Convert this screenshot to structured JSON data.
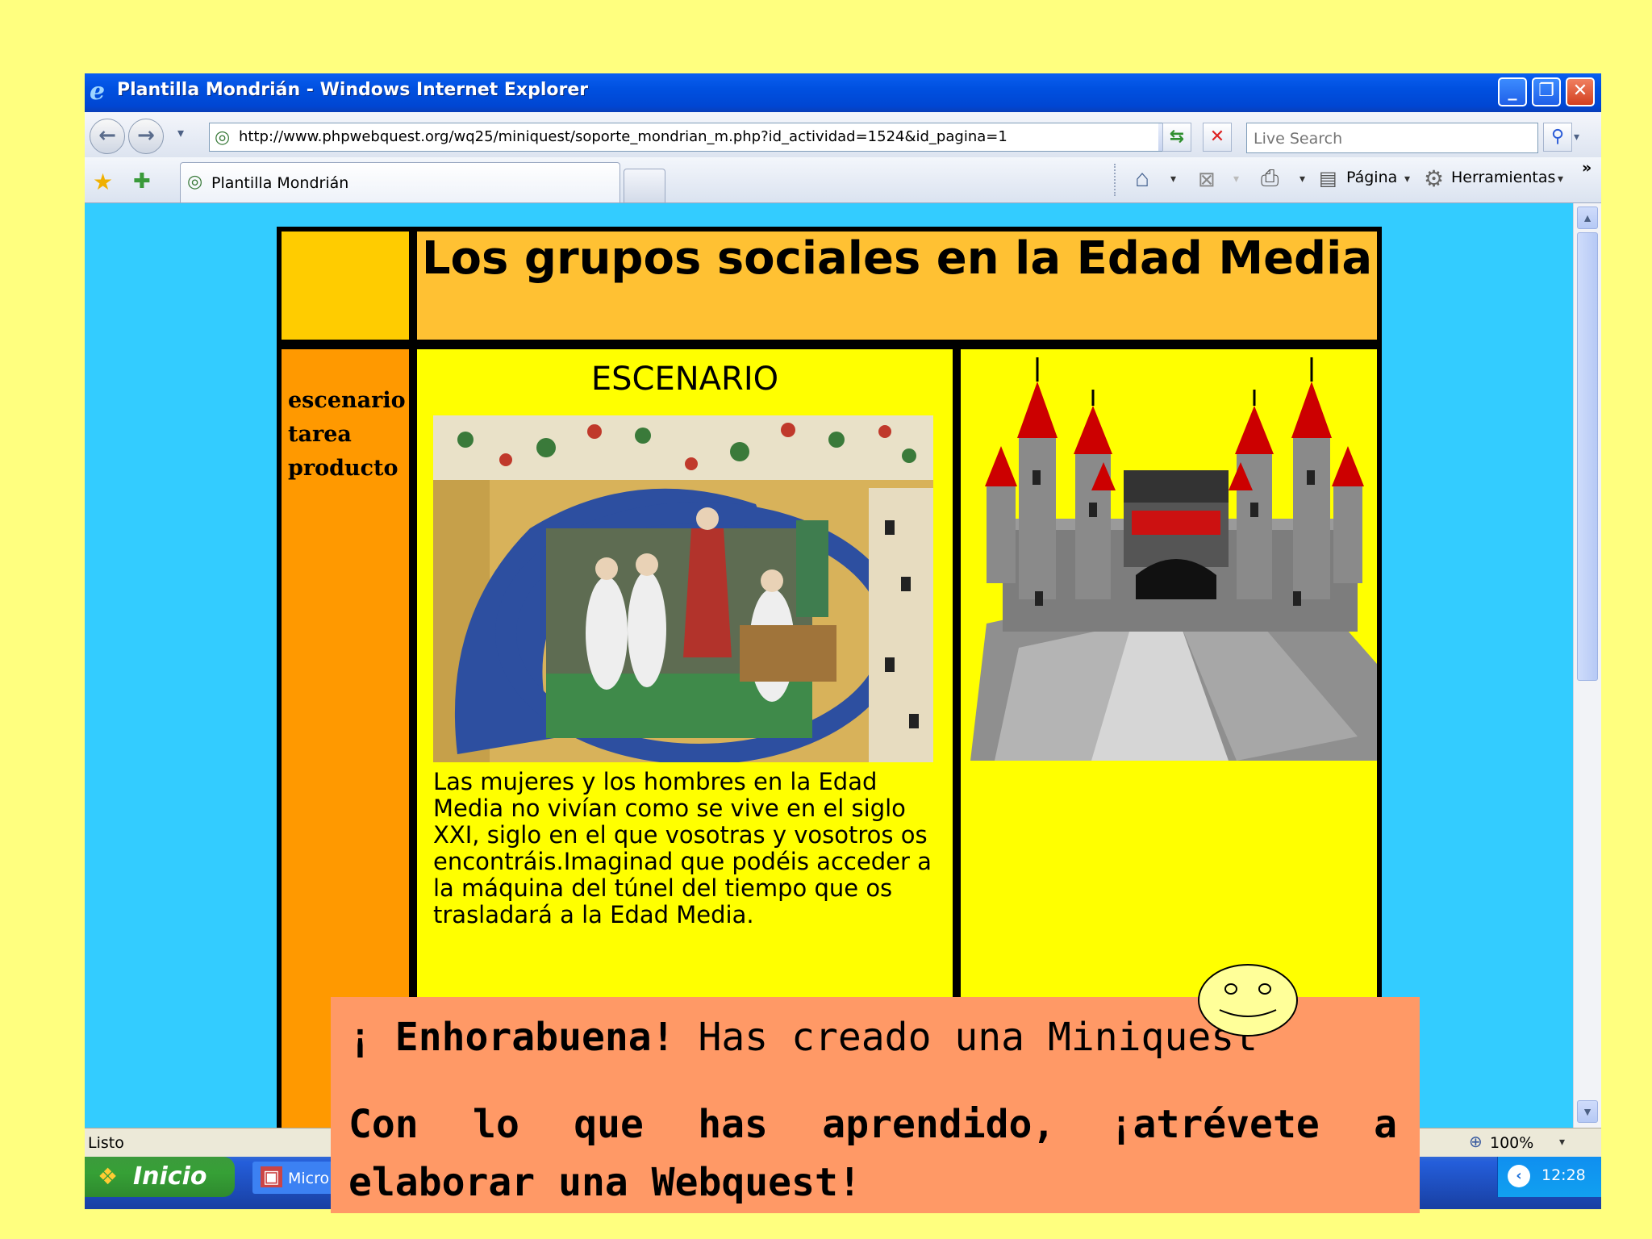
{
  "window": {
    "title": "Plantilla Mondrián - Windows Internet Explorer"
  },
  "toolbar": {
    "address": "http://www.phpwebquest.org/wq25/miniquest/soporte_mondrian_m.php?id_actividad=1524&id_pagina=1",
    "search_placeholder": "Live Search",
    "page_label": "Página",
    "tools_label": "Herramientas",
    "more": "»"
  },
  "tabs": [
    {
      "label": "Plantilla Mondrián"
    }
  ],
  "page": {
    "title": "Los grupos sociales en la Edad Media",
    "menu": [
      "escenario",
      "tarea",
      "producto"
    ],
    "section_heading": "ESCENARIO",
    "intro_text": "Las mujeres y los hombres en la Edad Media no vivían como se vive en el siglo XXI, siglo en el que vosotras y vosotros os encontráis.Imaginad que podéis acceder a la máquina del túnel del tiempo que os trasladará a la Edad Media."
  },
  "status": {
    "text": "Listo",
    "zoom": "100%"
  },
  "taskbar": {
    "start_label": "Inicio",
    "task_label": "Micro",
    "clock": "12:28"
  },
  "overlay": {
    "bold_part": "¡ Enhorabuena!",
    "rest": " Has creado una Miniquest",
    "line2": "Con lo que has aprendido, ¡atrévete a elaborar una Webquest!"
  },
  "colors": {
    "desktop_bg": "#ffff7f",
    "content_bg": "#33ccff",
    "header_cell": "#ffc133",
    "menu_cell": "#ff9900",
    "main_cell": "#ffff00",
    "note_bg": "#ff9966"
  }
}
